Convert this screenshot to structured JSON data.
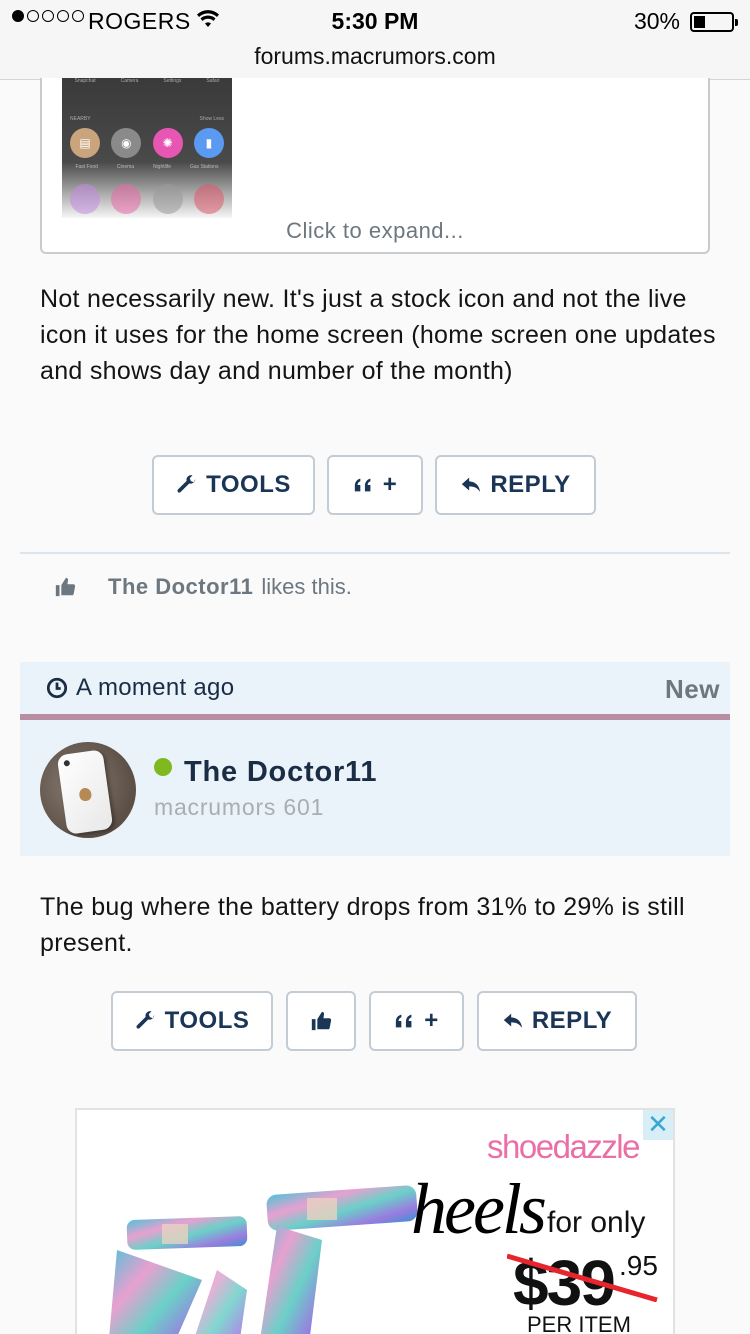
{
  "status_bar": {
    "carrier": "ROGERS",
    "time": "5:30 PM",
    "battery": "30%",
    "battery_level": 0.3,
    "signal_bars": 1,
    "url": "forums.macrumors.com"
  },
  "quote": {
    "expand_label": "Click to expand...",
    "screenshot_labels": {
      "top_items": [
        "Snapchat",
        "Camera",
        "Settings",
        "Safari"
      ],
      "nearby": "NEARBY",
      "show_less": "Show Less",
      "icon_labels": [
        "Fast Food",
        "Cinema",
        "Nightlife",
        "Gas Stations"
      ]
    }
  },
  "post1": {
    "message": "Not necessarily new. It's just a stock icon and not the live icon it uses for the home screen (home screen one updates and shows day and number of the month)",
    "buttons": {
      "tools": "TOOLS",
      "quote": "+",
      "reply": "REPLY"
    },
    "likes": {
      "user": "The Doctor11",
      "text": "likes this."
    }
  },
  "post2": {
    "time": "A moment ago",
    "badge": "New",
    "author": {
      "name": "The Doctor11",
      "title": "macrumors 601",
      "online_color": "#7fb91f"
    },
    "message": "The bug where the battery drops from 31% to 29% is still present.",
    "buttons": {
      "tools": "TOOLS",
      "quote": "+",
      "reply": "REPLY"
    }
  },
  "ad": {
    "brand": "shoedazzle",
    "headline": "heels",
    "for_only": "for only",
    "old_price": "$39",
    "cents": ".95",
    "per_item": "PER ITEM",
    "close_label": "✕"
  },
  "colors": {
    "accent_text": "#1a3556",
    "post_header_bg": "#eaf2fa",
    "post_bar": "#b88fa2",
    "brand_pink": "#ea6fa7"
  }
}
